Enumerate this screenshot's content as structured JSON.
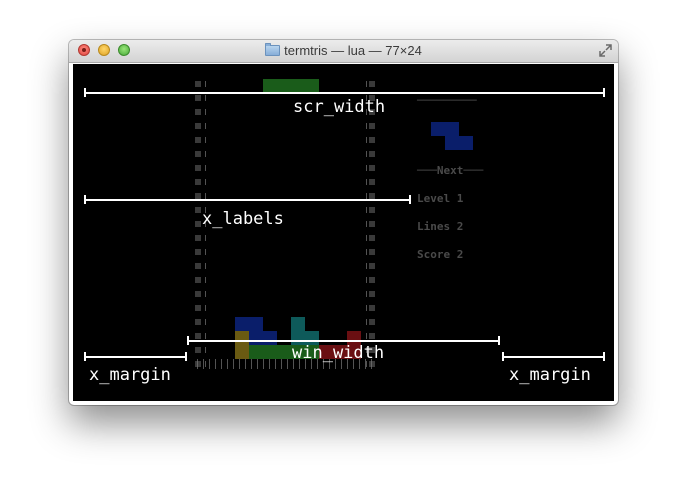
{
  "window": {
    "title": "termtris — lua — 77×24"
  },
  "sidebar": {
    "rule": "─────────",
    "next": "───Next───",
    "level": "Level 1",
    "lines": "Lines 2",
    "score": "Score 2"
  },
  "annotations": {
    "scr_width": "scr_width",
    "x_labels": "x_labels",
    "win_width": "win_width",
    "x_margin_left": "x_margin",
    "x_margin_right": "x_margin"
  },
  "colors": {
    "terminal_bg": "#000000",
    "piece_green": "#1a5c1a",
    "piece_blue": "#0a1e6a",
    "piece_teal": "#0e5a5a",
    "piece_red": "#6a0f12",
    "piece_yellow": "#6a5a12",
    "annotation": "#ffffff"
  },
  "icons": {
    "close": "close-icon",
    "minimize": "minimize-icon",
    "zoom": "zoom-icon",
    "folder": "folder-icon",
    "fullscreen": "fullscreen-icon"
  }
}
